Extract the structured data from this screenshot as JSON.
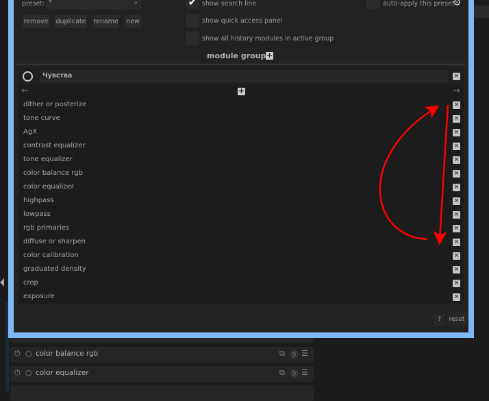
{
  "preset": {
    "label": "preset:",
    "value": "*"
  },
  "buttons": {
    "remove": "remove",
    "duplicate": "duplicate",
    "rename": "rename",
    "new": "new",
    "help": "?",
    "reset": "reset"
  },
  "options": {
    "search_line": "show search line",
    "quick_access": "show quick access panel",
    "history_modules": "show all history modules in active group",
    "auto_apply": "auto-apply this preset"
  },
  "module_groups_title": "module groups",
  "group": {
    "name": "Чувства"
  },
  "modules": [
    "dither or posterize",
    "tone curve",
    "AgX",
    "contrast equalizer",
    "tone equalizer",
    "color balance rgb",
    "color equalizer",
    "highpass",
    "lowpass",
    "rgb primaries",
    "diffuse or sharpen",
    "color calibration",
    "graduated density",
    "crop",
    "exposure"
  ],
  "background_modules": [
    "color balance rgb",
    "color equalizer"
  ],
  "colors": {
    "accent": "#7fb8f6",
    "annotation": "#ff0000"
  }
}
